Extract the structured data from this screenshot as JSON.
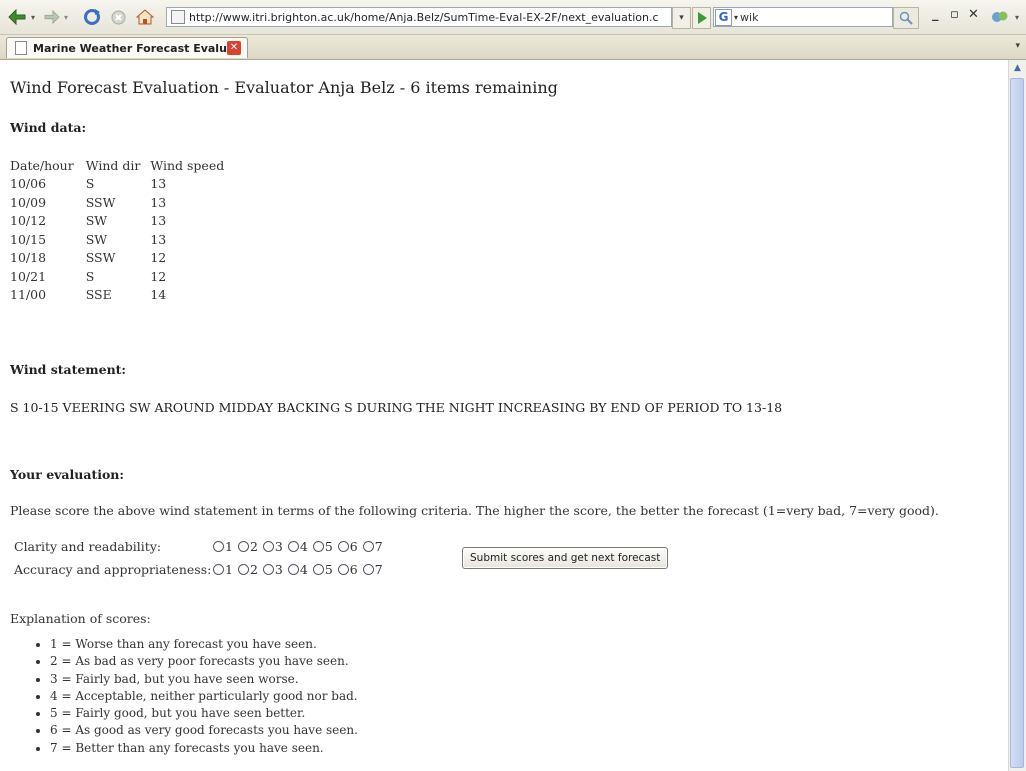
{
  "browser": {
    "url": "http://www.itri.brighton.ac.uk/home/Anja.Belz/SumTime-Eval-EX-2F/next_evaluation.cgi?FirstNa",
    "search_text": "wik",
    "tab_title": "Marine Weather Forecast Evalua...",
    "google_letter": "G"
  },
  "page": {
    "title": "Wind Forecast Evaluation - Evaluator Anja Belz - 6 items remaining",
    "wind_data_heading": "Wind data:",
    "columns": [
      "Date/hour",
      "Wind dir",
      "Wind speed"
    ],
    "rows": [
      [
        "10/06",
        "S",
        "13"
      ],
      [
        "10/09",
        "SSW",
        "13"
      ],
      [
        "10/12",
        "SW",
        "13"
      ],
      [
        "10/15",
        "SW",
        "13"
      ],
      [
        "10/18",
        "SSW",
        "12"
      ],
      [
        "10/21",
        "S",
        "12"
      ],
      [
        "11/00",
        "SSE",
        "14"
      ]
    ],
    "statement_heading": "Wind statement:",
    "statement": "S 10-15 VEERING SW AROUND MIDDAY BACKING S DURING THE NIGHT INCREASING BY END OF PERIOD TO 13-18",
    "evaluation_heading": "Your evaluation:",
    "instructions": "Please score the above wind statement in terms of the following criteria. The higher the score, the better the forecast (1=very bad, 7=very good).",
    "criteria": [
      {
        "label": "Clarity and readability:",
        "options": [
          "1",
          "2",
          "3",
          "4",
          "5",
          "6",
          "7"
        ]
      },
      {
        "label": "Accuracy and appropriateness:",
        "options": [
          "1",
          "2",
          "3",
          "4",
          "5",
          "6",
          "7"
        ]
      }
    ],
    "submit_label": "Submit scores and get next forecast",
    "explanation_heading": "Explanation of scores:",
    "explanations": [
      "1 = Worse than any forecast you have seen.",
      "2 = As bad as very poor forecasts you have seen.",
      "3 = Fairly bad, but you have seen worse.",
      "4 = Acceptable, neither particularly good nor bad.",
      "5 = Fairly good, but you have seen better.",
      "6 = As good as very good forecasts you have seen.",
      "7 = Better than any forecasts you have seen."
    ]
  }
}
